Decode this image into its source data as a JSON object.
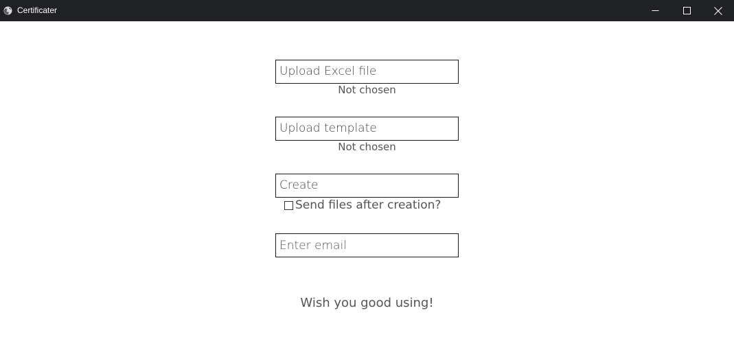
{
  "window": {
    "title": "Certificater",
    "app_icon": "globe-icon",
    "controls": {
      "minimize_icon": "minimize-icon",
      "maximize_icon": "maximize-icon",
      "close_icon": "close-icon"
    }
  },
  "form": {
    "excel_upload": {
      "label": "Upload Excel file",
      "status": "Not chosen"
    },
    "template_upload": {
      "label": "Upload template",
      "status": "Not chosen"
    },
    "create": {
      "label": "Create"
    },
    "send_files": {
      "label": "Send files after creation?",
      "checked": false
    },
    "email": {
      "placeholder": "Enter email",
      "value": ""
    }
  },
  "footer": {
    "message": "Wish you good using!"
  },
  "colors": {
    "titlebar_bg": "#202124",
    "titlebar_text": "#ffffff",
    "page_bg": "#ffffff",
    "border": "#1a1a1a",
    "text": "#555555"
  }
}
